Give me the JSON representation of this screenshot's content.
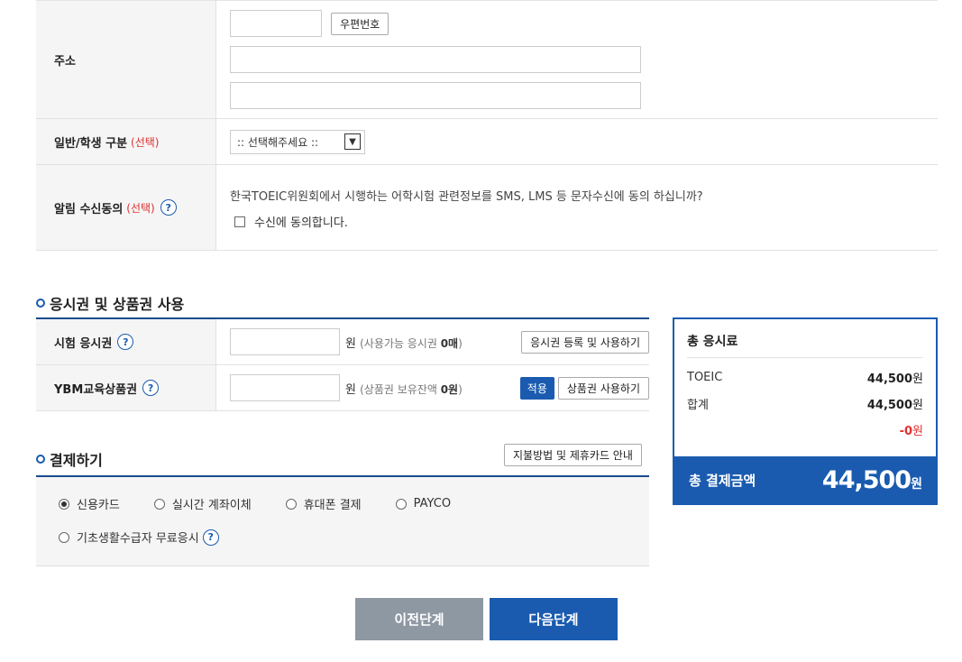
{
  "address": {
    "label": "주소",
    "zipcode_button": "우편번호",
    "zipcode_value": "",
    "address1_value": "",
    "address2_value": ""
  },
  "member_type": {
    "label": "일반/학생 구분",
    "optional": "(선택)",
    "select_value": ":: 선택해주세요 ::"
  },
  "notify": {
    "label": "알림 수신동의",
    "optional": "(선택)",
    "help": "?",
    "question": "한국TOEIC위원회에서 시행하는 어학시험 관련정보를 SMS, LMS 등 문자수신에 동의 하십니까?",
    "checkbox_label": "수신에 동의합니다.",
    "checked": false
  },
  "voucher_section": {
    "title": "응시권 및 상품권 사용",
    "rows": [
      {
        "label": "시험 응시권",
        "help": "?",
        "won": "원",
        "note_prefix": "(사용가능 응시권 ",
        "note_value": "0매",
        "note_suffix": ")",
        "apply_button": "",
        "action_button": "응시권 등록 및 사용하기"
      },
      {
        "label": "YBM교육상품권",
        "help": "?",
        "won": "원",
        "note_prefix": "(상품권 보유잔액 ",
        "note_value": "0원",
        "note_suffix": ")",
        "apply_button": "적용",
        "action_button": "상품권 사용하기"
      }
    ]
  },
  "payment_section": {
    "title": "결제하기",
    "guide_button": "지불방법 및 제휴카드 안내",
    "methods": [
      {
        "label": "신용카드",
        "selected": true
      },
      {
        "label": "실시간 계좌이체",
        "selected": false
      },
      {
        "label": "휴대폰 결제",
        "selected": false
      },
      {
        "label": "PAYCO",
        "selected": false
      }
    ],
    "free_label": "기초생활수급자 무료응시",
    "free_help": "?"
  },
  "summary": {
    "title": "총 응시료",
    "lines": [
      {
        "label": "TOEIC",
        "value": "44,500",
        "unit": "원"
      },
      {
        "label": "합계",
        "value": "44,500",
        "unit": "원"
      }
    ],
    "discount": "-0",
    "discount_unit": "원",
    "total_label": "총 결제금액",
    "total_value": "44,500",
    "total_unit": "원"
  },
  "nav": {
    "prev": "이전단계",
    "next": "다음단계"
  },
  "colors": {
    "primary": "#1a5bb0",
    "prev_button": "#8e98a3",
    "accent_red": "#e03030"
  }
}
